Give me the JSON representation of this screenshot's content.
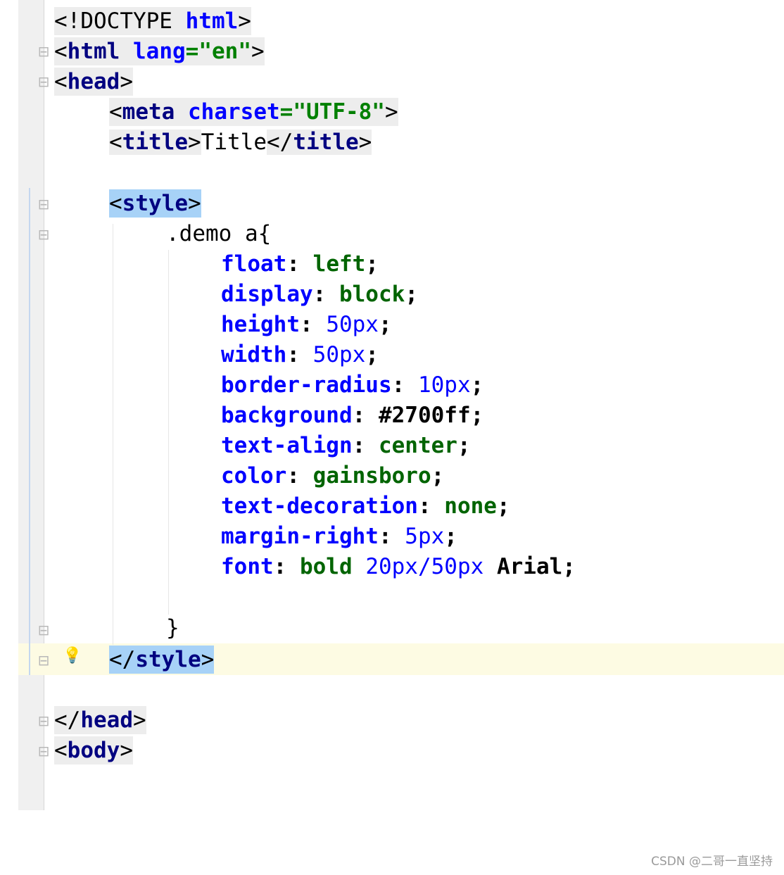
{
  "editor": {
    "lines": {
      "doctype": {
        "lt": "<!DOCTYPE ",
        "kw": "html",
        "gt": ">"
      },
      "html_open": {
        "lt": "<",
        "tag": "html",
        "sp": " ",
        "attr": "lang",
        "eq": "=",
        "value": "\"en\"",
        "gt": ">"
      },
      "head_open": {
        "lt": "<",
        "tag": "head",
        "gt": ">"
      },
      "meta": {
        "lt": "<",
        "tag": "meta",
        "sp": " ",
        "attr": "charset",
        "eq": "=",
        "value": "\"UTF-8\"",
        "gt": ">"
      },
      "title": {
        "lt1": "<",
        "tag1": "title",
        "gt1": ">",
        "text": "Title",
        "lt2": "</",
        "tag2": "title",
        "gt2": ">"
      },
      "style_open": {
        "lt": "<",
        "tag": "style",
        "gt": ">"
      },
      "selector": {
        "text": ".demo a{"
      },
      "css": [
        {
          "prop": "float",
          "colon": ": ",
          "value": "left",
          "semi": ";"
        },
        {
          "prop": "display",
          "colon": ": ",
          "value": "block",
          "semi": ";"
        },
        {
          "prop": "height",
          "colon": ": ",
          "num": "50px",
          "semi": ";"
        },
        {
          "prop": "width",
          "colon": ": ",
          "num": "50px",
          "semi": ";"
        },
        {
          "prop": "border-radius",
          "colon": ": ",
          "num": "10px",
          "semi": ";"
        },
        {
          "prop": "background",
          "colon": ": ",
          "value": "#2700ff",
          "semi": ";"
        },
        {
          "prop": "text-align",
          "colon": ": ",
          "value": "center",
          "semi": ";"
        },
        {
          "prop": "color",
          "colon": ": ",
          "value": "gainsboro",
          "semi": ";"
        },
        {
          "prop": "text-decoration",
          "colon": ": ",
          "value": "none",
          "semi": ";"
        },
        {
          "prop": "margin-right",
          "colon": ": ",
          "num": "5px",
          "semi": ";"
        },
        {
          "prop": "font",
          "colon": ": ",
          "value": "bold",
          "sp1": " ",
          "num": "20px/50px",
          "sp2": " ",
          "value2": "Arial",
          "semi": ";"
        }
      ],
      "rule_close": {
        "text": "}"
      },
      "style_close": {
        "lt": "</",
        "tag": "style",
        "gt": ">"
      },
      "head_close": {
        "lt": "</",
        "tag": "head",
        "gt": ">"
      },
      "body_open": {
        "lt": "<",
        "tag": "body",
        "gt": ">"
      }
    }
  },
  "watermark": {
    "text": "CSDN @二哥一直坚持"
  },
  "colors": {
    "tag": "#000080",
    "attribute": "#0000ff",
    "string": "#008000",
    "css_property": "#0000ff",
    "css_value": "#006400",
    "number": "#0000ff",
    "selection": "#a7d2f7",
    "caret_line": "#fdfbe3"
  },
  "icons": [
    "fold-toggle-icon",
    "intention-bulb-icon"
  ]
}
